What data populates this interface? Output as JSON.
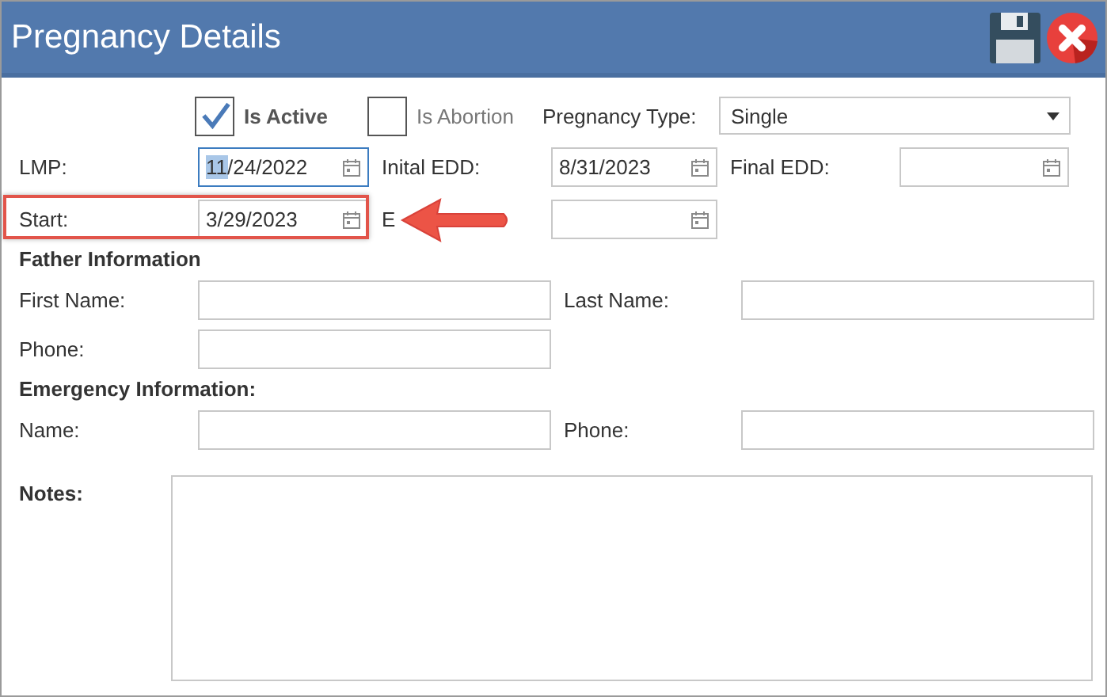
{
  "window": {
    "title": "Pregnancy Details"
  },
  "checkboxes": [
    {
      "label": "Is Active",
      "checked": true
    },
    {
      "label": "Is Abortion",
      "checked": false
    }
  ],
  "pregnancy_type": {
    "label": "Pregnancy Type:",
    "value": "Single"
  },
  "date_rows": [
    [
      {
        "label": "LMP:",
        "value": "11/24/2022",
        "focused": true,
        "highlighted": false
      },
      {
        "label": "Inital EDD:",
        "value": "8/31/2023",
        "focused": false,
        "highlighted": false
      },
      {
        "label": "Final EDD:",
        "focused": false,
        "highlighted": false
      }
    ],
    [
      {
        "label": "Start:",
        "value": "3/29/2023",
        "focused": false,
        "highlighted": true
      },
      {
        "label": "E",
        "focused": false,
        "highlighted": false
      }
    ]
  ],
  "sections": [
    {
      "title": "Father Information",
      "rows": [
        [
          {
            "label": "First Name:"
          },
          {
            "label": "Last Name:"
          }
        ],
        [
          {
            "label": "Phone:"
          }
        ]
      ]
    },
    {
      "title": "Emergency Information:",
      "rows": [
        [
          {
            "label": "Name:"
          },
          {
            "label": "Phone:"
          }
        ]
      ]
    }
  ],
  "notes": {
    "label": "Notes:"
  }
}
